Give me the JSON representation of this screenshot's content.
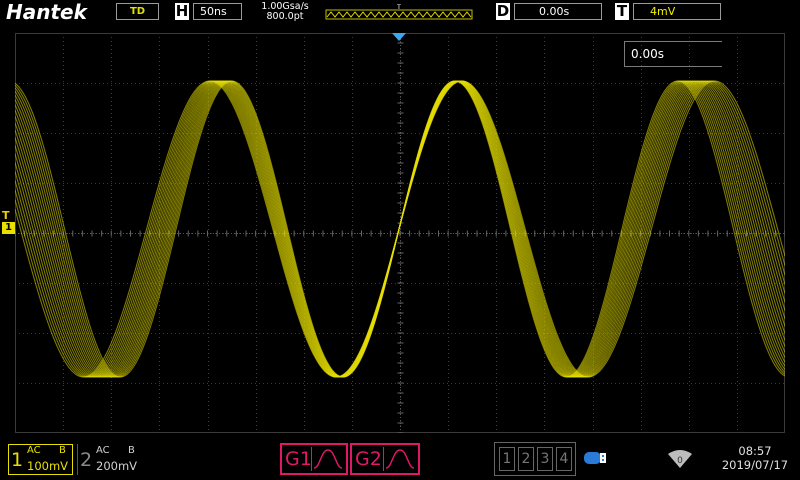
{
  "brand": "Hantek",
  "top_bar": {
    "mode": "TD",
    "horizontal": {
      "key": "H",
      "value": "50ns"
    },
    "sample_rate": "1.00Gsa/s",
    "memory_depth": "800.0pt",
    "delay": {
      "key": "D",
      "value": "0.00s"
    },
    "trigger": {
      "key": "T",
      "value": "4mV"
    },
    "trigger_marker": "T"
  },
  "screen": {
    "cursor_readout": "0.00s",
    "trigger_level_marker": "T",
    "channel_marker": "1",
    "waveform_color": "#e8e000",
    "grid_color": "#3a3a3a"
  },
  "bottom_bar": {
    "ch1": {
      "number": "1",
      "coupling": "AC",
      "bandwidth": "B",
      "volts_div": "100mV",
      "color": "#e8e000"
    },
    "ch2": {
      "number": "2",
      "coupling": "AC",
      "bandwidth": "B",
      "volts_div": "200mV"
    },
    "generators": [
      {
        "label": "G1",
        "color": "#e01868"
      },
      {
        "label": "G2",
        "color": "#e01868"
      }
    ],
    "math_buttons": [
      "1",
      "2",
      "3",
      "4"
    ],
    "usb_icon": "usb-icon",
    "wifi_icon": "wifi-icon",
    "wifi_count": "0",
    "time": "08:57",
    "date": "2019/07/17"
  }
}
